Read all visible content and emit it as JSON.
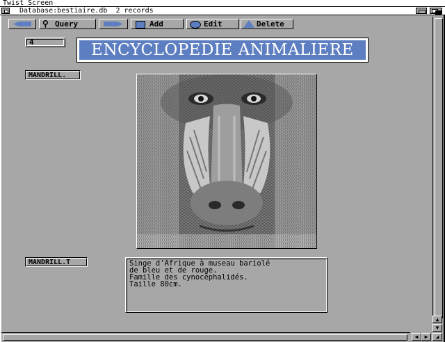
{
  "screen": {
    "title": "Twist Screen"
  },
  "window": {
    "title": "Database:bestiaire.db",
    "records": "2 records"
  },
  "toolbar": {
    "query_label": "Query",
    "add_label": "Add",
    "edit_label": "Edit",
    "delete_label": "Delete"
  },
  "record": {
    "number": "4",
    "banner": "ENCYCLOPEDIE ANIMALIERE",
    "image_field_label": "MANDRILL.",
    "text_field_label": "MANDRILL.T",
    "description": "Singe d'Afrique à museau bariolé\nde bleu et de rouge.\nFamille des cynocéphalidés.\nTaille 80cm."
  },
  "colors": {
    "workbench_gray": "#a7a7a7",
    "accent_blue": "#5d7fc2"
  }
}
